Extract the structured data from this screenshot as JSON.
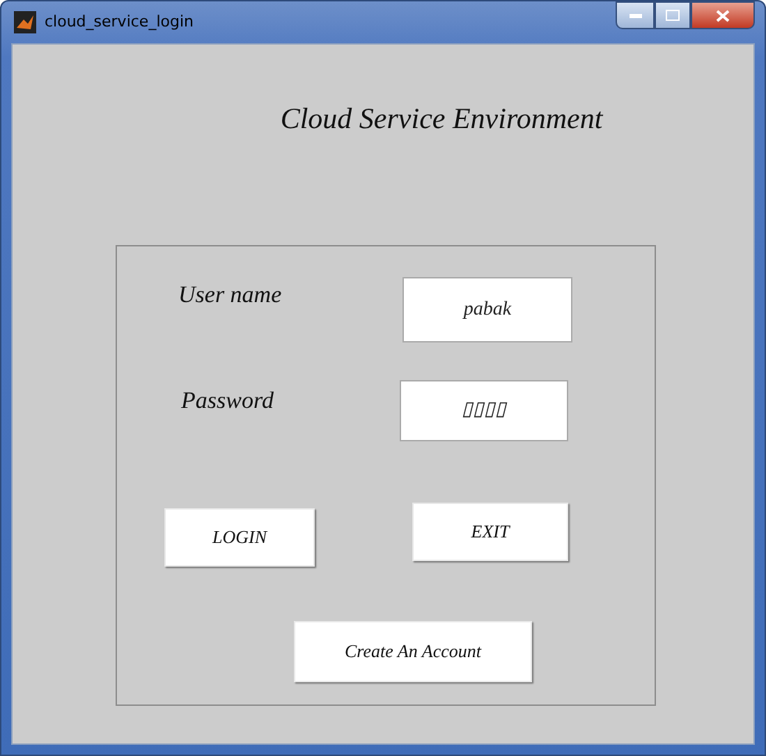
{
  "window": {
    "title": "cloud_service_login"
  },
  "heading": "Cloud Service Environment",
  "form": {
    "username": {
      "label": "User name",
      "value": "pabak"
    },
    "password": {
      "label": "Password",
      "value": "▯▯▯▯"
    }
  },
  "buttons": [
    {
      "label": "LOGIN"
    },
    {
      "label": "EXIT"
    },
    {
      "label": "Create An Account"
    }
  ]
}
